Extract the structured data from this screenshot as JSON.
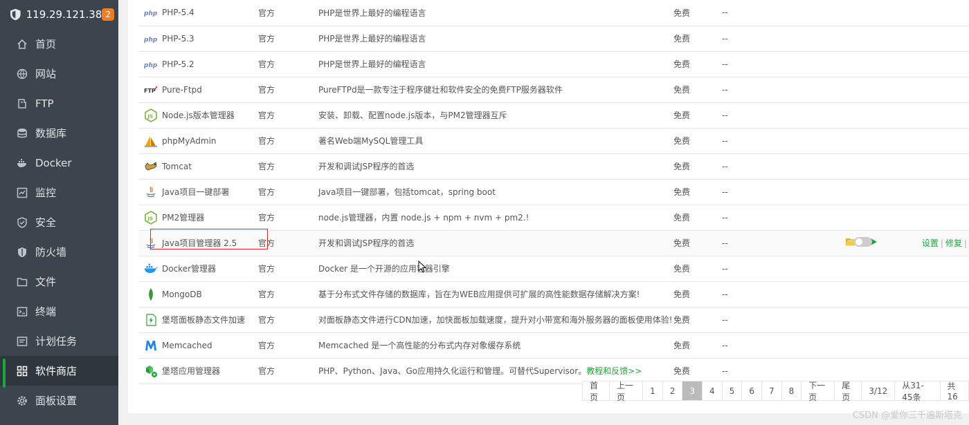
{
  "server": {
    "ip": "119.29.121.38",
    "badge": "2"
  },
  "sidebar": {
    "items": [
      {
        "label": "首页",
        "icon": "home-icon"
      },
      {
        "label": "网站",
        "icon": "globe-icon"
      },
      {
        "label": "FTP",
        "icon": "ftp-icon"
      },
      {
        "label": "数据库",
        "icon": "database-icon"
      },
      {
        "label": "Docker",
        "icon": "docker-icon"
      },
      {
        "label": "监控",
        "icon": "monitor-icon"
      },
      {
        "label": "安全",
        "icon": "shield-check-icon"
      },
      {
        "label": "防火墙",
        "icon": "firewall-icon"
      },
      {
        "label": "文件",
        "icon": "folder-icon"
      },
      {
        "label": "终端",
        "icon": "terminal-icon"
      },
      {
        "label": "计划任务",
        "icon": "clock-icon"
      },
      {
        "label": "软件商店",
        "icon": "grid-icon",
        "active": true
      },
      {
        "label": "面板设置",
        "icon": "gear-icon"
      }
    ]
  },
  "rows": [
    {
      "name": "PHP-5.4",
      "type": "官方",
      "desc": "PHP是世界上最好的编程语言",
      "price": "免费",
      "expire": "--",
      "icon": "php-icon"
    },
    {
      "name": "PHP-5.3",
      "type": "官方",
      "desc": "PHP是世界上最好的编程语言",
      "price": "免费",
      "expire": "--",
      "icon": "php-icon"
    },
    {
      "name": "PHP-5.2",
      "type": "官方",
      "desc": "PHP是世界上最好的编程语言",
      "price": "免费",
      "expire": "--",
      "icon": "php-icon"
    },
    {
      "name": "Pure-Ftpd",
      "type": "官方",
      "desc": "PureFTPd是一款专注于程序健壮和软件安全的免费FTP服务器软件",
      "price": "免费",
      "expire": "--",
      "icon": "ftp-logo-icon"
    },
    {
      "name": "Node.js版本管理器",
      "type": "官方",
      "desc": "安装、卸载、配置node.js版本，与PM2管理器互斥",
      "price": "免费",
      "expire": "--",
      "icon": "nodejs-icon"
    },
    {
      "name": "phpMyAdmin",
      "type": "官方",
      "desc": "著名Web端MySQL管理工具",
      "price": "免费",
      "expire": "--",
      "icon": "phpmyadmin-icon"
    },
    {
      "name": "Tomcat",
      "type": "官方",
      "desc": "开发和调试JSP程序的首选",
      "price": "免费",
      "expire": "--",
      "icon": "tomcat-icon"
    },
    {
      "name": "Java项目一键部署",
      "type": "官方",
      "desc": "Java项目一键部署，包括tomcat，spring boot",
      "price": "免费",
      "expire": "--",
      "icon": "java-icon"
    },
    {
      "name": "PM2管理器",
      "type": "官方",
      "desc": "node.js管理器，内置 node.js + npm + nvm + pm2.!",
      "price": "免费",
      "expire": "--",
      "icon": "nodejs-icon"
    },
    {
      "name": "Java项目管理器 2.5",
      "type": "官方",
      "desc": "开发和调试JSP程序的首选",
      "price": "免费",
      "expire": "--",
      "icon": "java-icon",
      "installed": true
    },
    {
      "name": "Docker管理器",
      "type": "官方",
      "desc": "Docker 是一个开源的应用容器引擎",
      "price": "免费",
      "expire": "--",
      "icon": "docker-logo-icon"
    },
    {
      "name": "MongoDB",
      "type": "官方",
      "desc": "基于分布式文件存储的数据库，旨在为WEB应用提供可扩展的高性能数据存储解决方案!",
      "price": "免费",
      "expire": "--",
      "icon": "mongodb-icon"
    },
    {
      "name": "堡塔面板静态文件加速",
      "type": "官方",
      "desc": "对面板静态文件进行CDN加速，加快面板加载速度，提升对小带宽和海外服务器的面板使用体验!",
      "price": "免费",
      "expire": "--",
      "icon": "speed-icon"
    },
    {
      "name": "Memcached",
      "type": "官方",
      "desc": "Memcached 是一个高性能的分布式内存对象缓存系统",
      "price": "免费",
      "expire": "--",
      "icon": "memcached-icon"
    },
    {
      "name": "堡塔应用管理器",
      "type": "官方",
      "desc": "PHP、Python、Java、Go应用持久化运行和管理。可替代Supervisor。",
      "desc_link": "教程和反馈>>",
      "price": "免费",
      "expire": "--",
      "icon": "app-manager-icon"
    }
  ],
  "installed_ops": {
    "settings": "设置",
    "repair": "修复",
    "sep": "|"
  },
  "pagination": {
    "first": "首页",
    "prev": "上一页",
    "pages": [
      "1",
      "2",
      "3",
      "4",
      "5",
      "6",
      "7",
      "8"
    ],
    "current": "3",
    "next": "下一页",
    "last": "尾页",
    "page_info": "3/12",
    "range": "从31-45条",
    "total": "共16"
  },
  "watermark": "CSDN @爱你三千遍斯塔克",
  "colors": {
    "sidebar_bg": "#3c444d",
    "accent": "#20a53a",
    "badge": "#f27c22",
    "highlight": "#d9282f"
  }
}
